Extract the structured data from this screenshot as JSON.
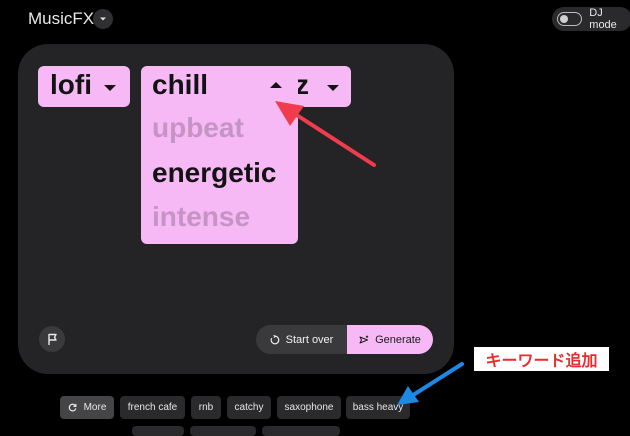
{
  "header": {
    "app_title": "MusicFX",
    "dj_mode_label": "DJ mode",
    "dj_mode_on": false
  },
  "prompt": {
    "chips": [
      {
        "label": "lofi"
      },
      {
        "label": "chill"
      },
      {
        "label": "z"
      }
    ],
    "dropdown_options": [
      "upbeat",
      "energetic",
      "intense"
    ]
  },
  "actions": {
    "start_over_label": "Start over",
    "generate_label": "Generate"
  },
  "keywords": {
    "more_label": "More",
    "items": [
      "french cafe",
      "rnb",
      "catchy",
      "saxophone",
      "bass heavy"
    ]
  },
  "annotation": {
    "text": "キーワード追加"
  },
  "colors": {
    "chip_accent": "#f7b9f5",
    "arrow_red": "#f03c4c",
    "arrow_blue": "#1e88e5",
    "annotation_text": "#e62e2e"
  }
}
